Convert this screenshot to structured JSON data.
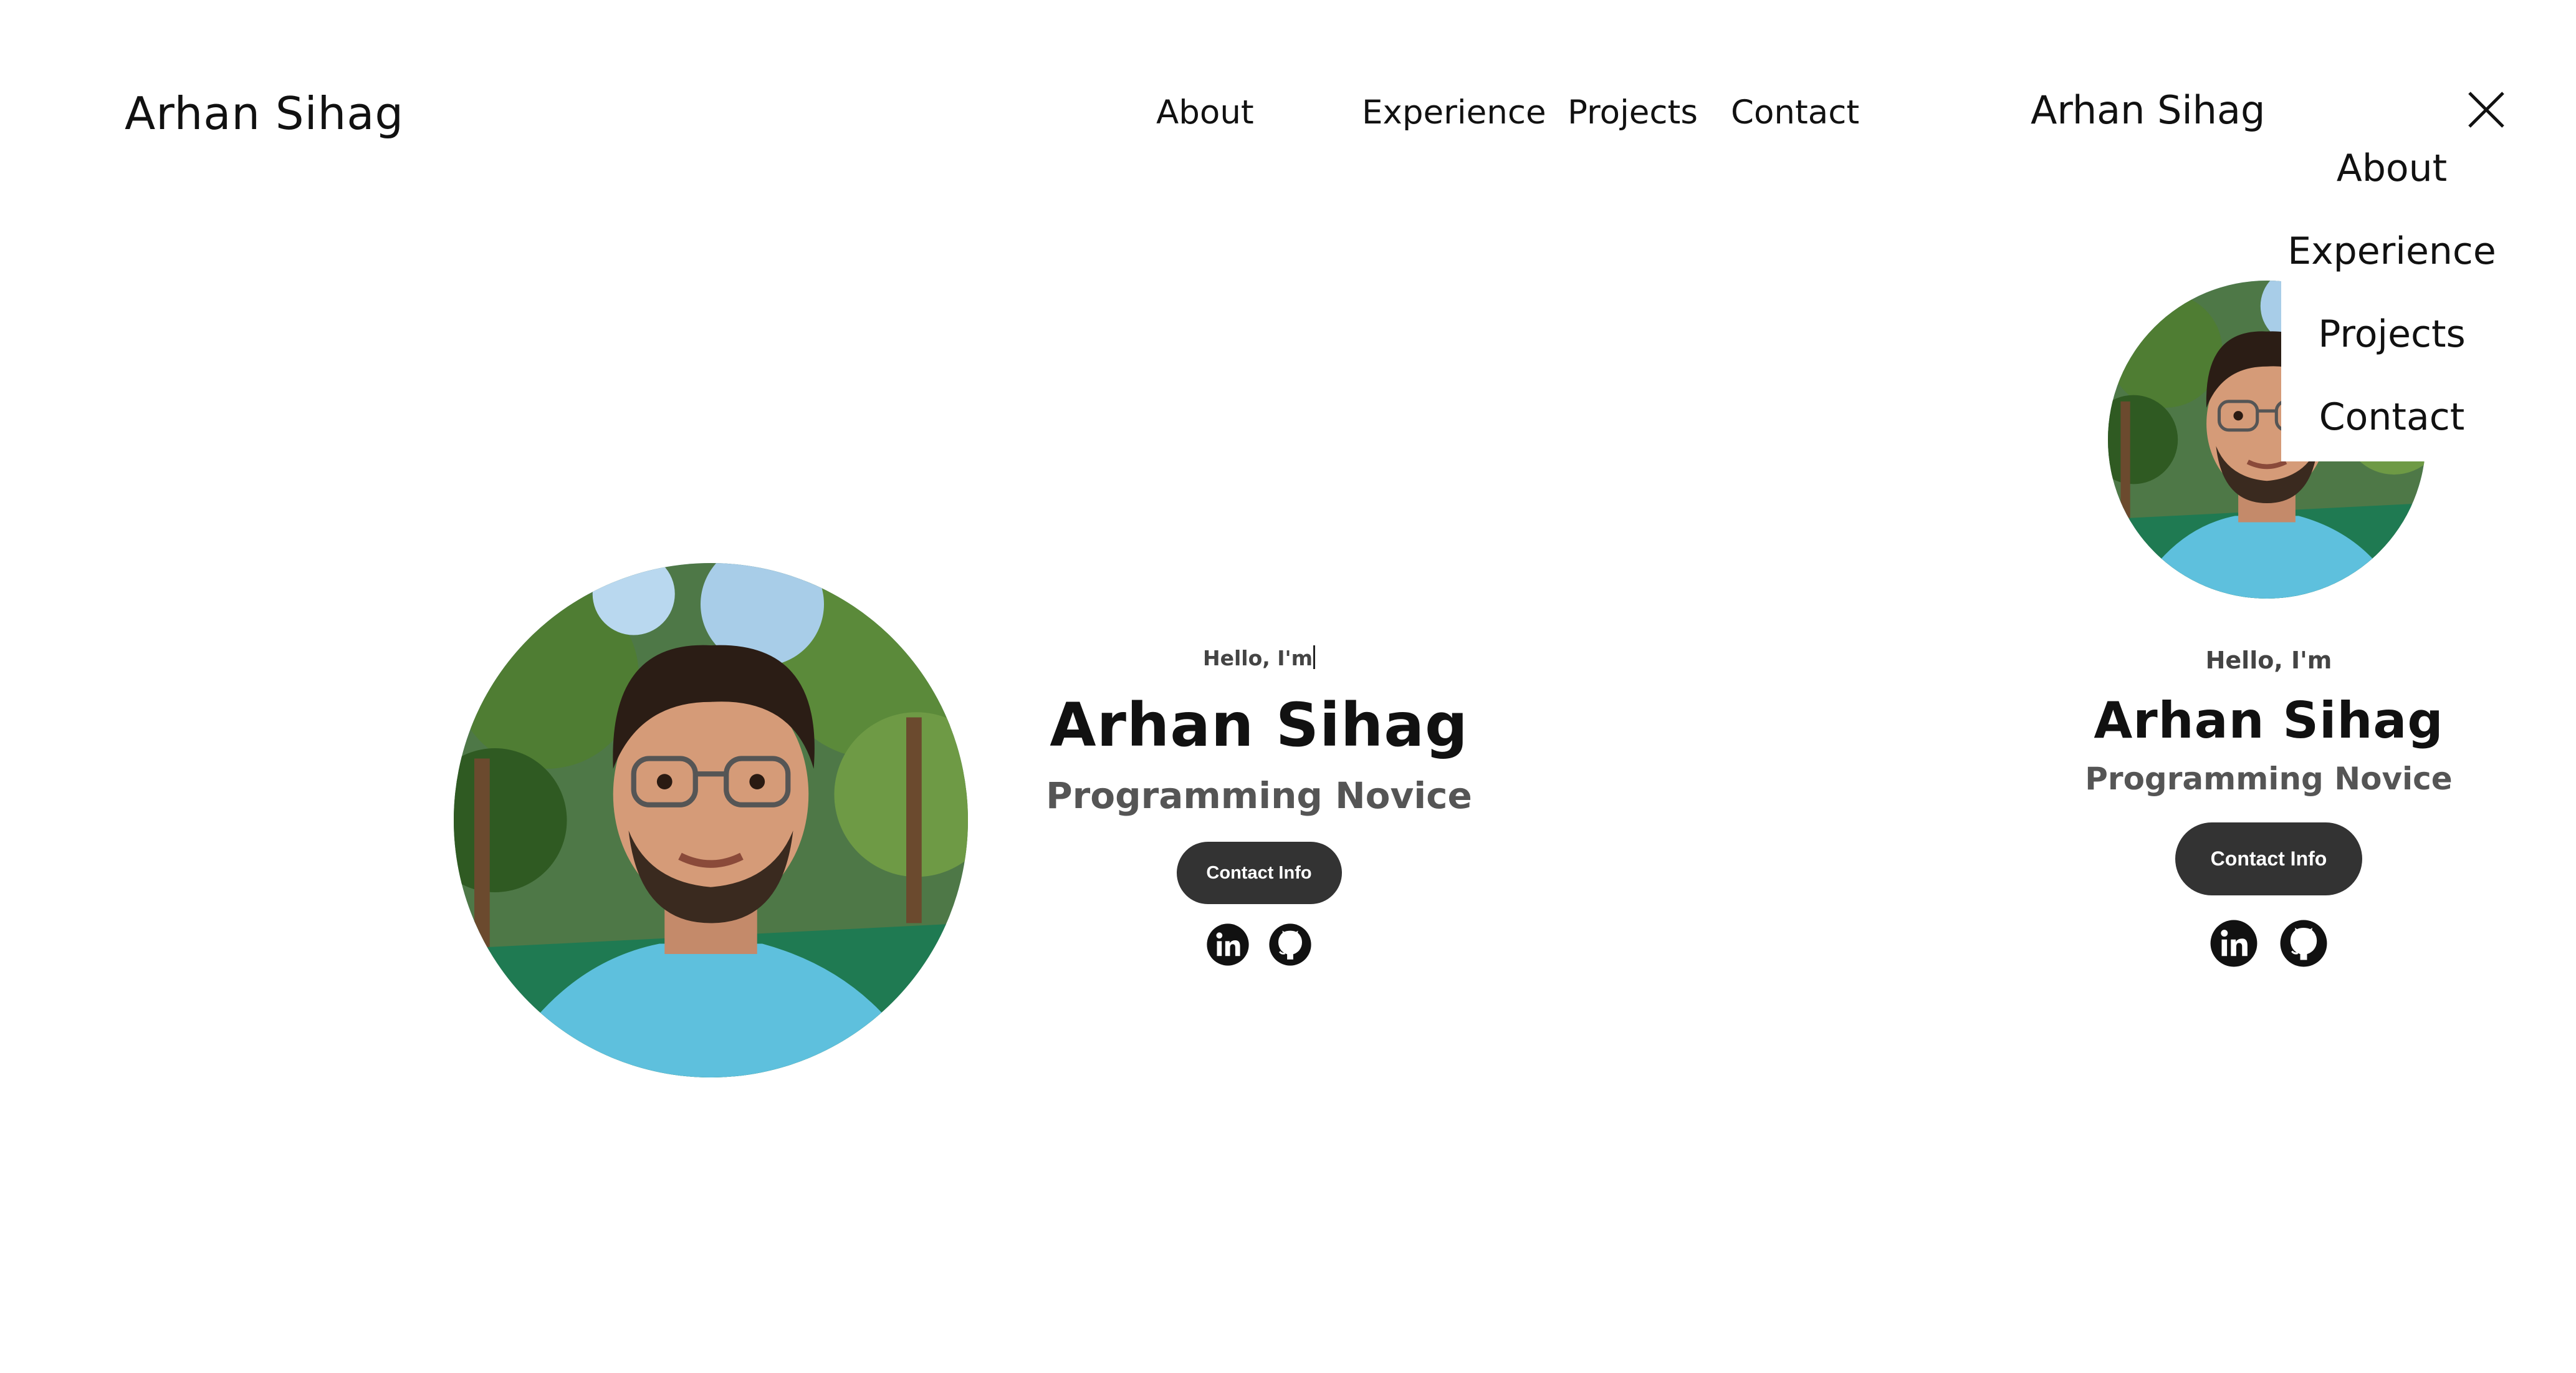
{
  "desktop": {
    "logo": "Arhan Sihag",
    "nav": {
      "about": "About",
      "experience": "Experience",
      "projects": "Projects",
      "contact": "Contact"
    },
    "hero": {
      "greeting": "Hello, I'm",
      "name": "Arhan Sihag",
      "role": "Programming Novice",
      "contact_button": "Contact Info"
    }
  },
  "mobile": {
    "logo": "Arhan Sihag",
    "menu": {
      "about": "About",
      "experience": "Experience",
      "projects": "Projects",
      "contact": "Contact"
    },
    "hero": {
      "greeting": "Hello, I'm",
      "name": "Arhan Sihag",
      "role": "Programming Novice",
      "contact_button": "Contact Info"
    }
  },
  "icons": {
    "linkedin": "linkedin-icon",
    "github": "github-icon",
    "close": "close-icon"
  },
  "colors": {
    "button_bg": "#333333",
    "button_text": "#ffffff",
    "heading": "#111111",
    "subtitle": "#555555",
    "background": "#ffffff"
  }
}
